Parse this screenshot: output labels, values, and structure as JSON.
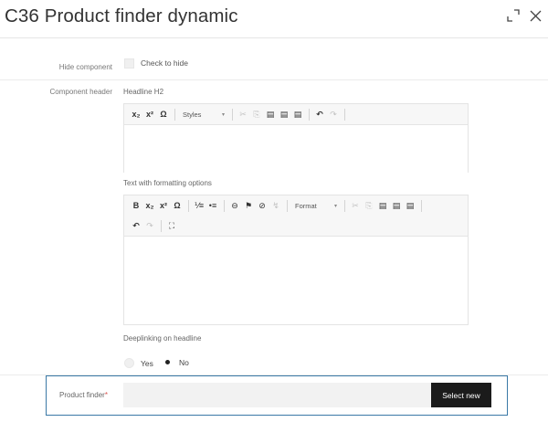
{
  "dialog": {
    "title": "C36 Product finder dynamic",
    "expand_icon": "expand-icon",
    "close_icon": "close-icon"
  },
  "hide_component": {
    "label": "Hide component",
    "checkbox_label": "Check to hide",
    "checked": false
  },
  "component_header": {
    "label": "Component header",
    "headline_label": "Headline H2",
    "headline_toolbar": {
      "subscript": "x₂",
      "superscript": "x²",
      "special_char": "Ω",
      "styles_select": "Styles",
      "styles_arrow": "▾",
      "cut": "✂",
      "copy": "⎘",
      "paste": "▤",
      "paste_text": "▤",
      "paste_word": "▤",
      "undo": "↶",
      "redo": "↷"
    },
    "text_label": "Text with formatting options",
    "text_toolbar": {
      "bold": "B",
      "subscript": "x₂",
      "superscript": "x²",
      "special_char": "Ω",
      "numbered_list": "⅟≡",
      "bulleted_list": "•≡",
      "link": "⊖",
      "anchor": "⚑",
      "unlink": "⊘",
      "spellcheck": "↯",
      "format_select": "Format",
      "format_arrow": "▾",
      "cut": "✂",
      "copy": "⎘",
      "paste": "▤",
      "paste_text": "▤",
      "paste_word": "▤",
      "undo": "↶",
      "redo": "↷",
      "maximize": "⛶"
    },
    "deeplinking_label": "Deeplinking on headline",
    "deeplinking_options": [
      {
        "label": "Yes",
        "selected": false
      },
      {
        "label": "No",
        "selected": true
      }
    ]
  },
  "product_finder": {
    "label": "Product finder",
    "required_mark": "*",
    "value": "",
    "button_label": "Select new"
  }
}
